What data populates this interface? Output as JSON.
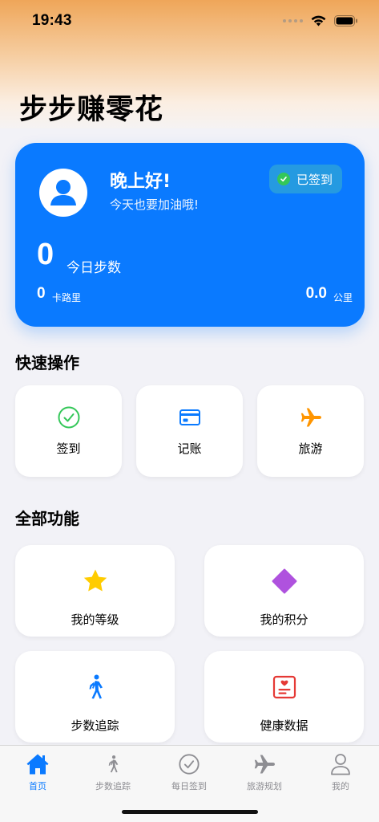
{
  "status": {
    "time": "19:43"
  },
  "app": {
    "title": "步步赚零花"
  },
  "user_card": {
    "greeting": "晚上好!",
    "subtitle": "今天也要加油哦!",
    "signed_label": "已签到",
    "steps_value": "0",
    "steps_label": "今日步数",
    "calories_value": "0",
    "calories_label": "卡路里",
    "distance_value": "0.0",
    "distance_label": "公里"
  },
  "quick_actions": {
    "title": "快速操作",
    "items": [
      {
        "label": "签到",
        "icon": "checkmark-circle-icon"
      },
      {
        "label": "记账",
        "icon": "credit-card-icon"
      },
      {
        "label": "旅游",
        "icon": "airplane-icon"
      }
    ]
  },
  "features": {
    "title": "全部功能",
    "items": [
      {
        "label": "我的等级",
        "icon": "star-icon"
      },
      {
        "label": "我的积分",
        "icon": "diamond-icon"
      },
      {
        "label": "步数追踪",
        "icon": "walking-figure-icon"
      },
      {
        "label": "健康数据",
        "icon": "heart-document-icon"
      }
    ]
  },
  "tabbar": {
    "items": [
      {
        "label": "首页",
        "icon": "house-icon",
        "active": true
      },
      {
        "label": "步数追踪",
        "icon": "walking-figure-icon"
      },
      {
        "label": "每日签到",
        "icon": "checkmark-circle-icon"
      },
      {
        "label": "旅游规划",
        "icon": "airplane-icon"
      },
      {
        "label": "我的",
        "icon": "person-icon"
      }
    ]
  },
  "colors": {
    "accent": "#0A7AFF",
    "check_green": "#34C759",
    "star_yellow": "#FFCC00",
    "diamond_purple": "#AF52DE",
    "health_red": "#E53935",
    "airplane_orange": "#FF9500"
  }
}
